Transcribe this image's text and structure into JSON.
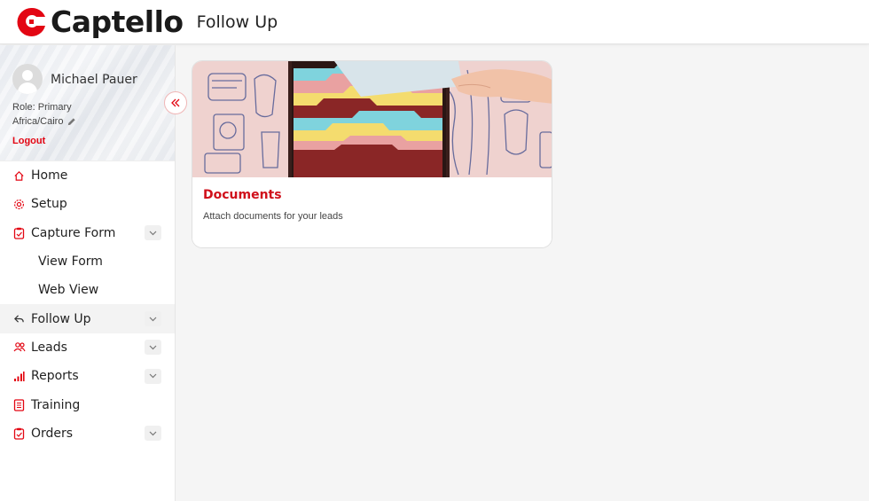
{
  "app": {
    "brand": "Captello",
    "page_title": "Follow Up"
  },
  "user": {
    "name": "Michael Pauer",
    "role": "Role: Primary",
    "timezone": "Africa/Cairo",
    "logout_label": "Logout"
  },
  "sidebar": {
    "items": [
      {
        "label": "Home",
        "icon": "home-icon"
      },
      {
        "label": "Setup",
        "icon": "gear-icon"
      },
      {
        "label": "Capture Form",
        "icon": "clipboard-icon",
        "expandable": true
      },
      {
        "label": "View Form"
      },
      {
        "label": "Web View"
      },
      {
        "label": "Follow Up",
        "icon": "reply-icon",
        "expandable": true,
        "active": true
      },
      {
        "label": "Leads",
        "icon": "users-icon",
        "expandable": true
      },
      {
        "label": "Reports",
        "icon": "bar-chart-icon",
        "expandable": true
      },
      {
        "label": "Training",
        "icon": "list-icon"
      },
      {
        "label": "Orders",
        "icon": "clipboard-icon",
        "expandable": true
      }
    ]
  },
  "cards": [
    {
      "title": "Documents",
      "description": "Attach documents for your leads"
    }
  ],
  "colors": {
    "accent": "#e30613",
    "card_title": "#d0101b",
    "background": "#f5f5f5"
  }
}
